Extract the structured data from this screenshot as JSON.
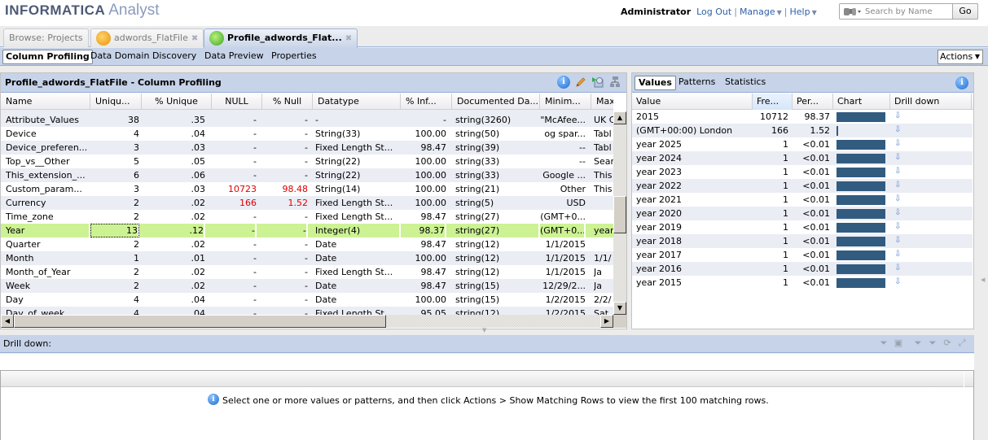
{
  "header": {
    "brand": "INFORMATICA",
    "product": "Analyst",
    "user": "Administrator",
    "logout": "Log Out",
    "manage": "Manage",
    "help": "Help",
    "search_placeholder": "Search by Name",
    "search_value": "",
    "go": "Go"
  },
  "tabs": [
    {
      "label": "Browse: Projects",
      "icon": "none",
      "closable": false,
      "active": false
    },
    {
      "label": "adwords_FlatFile",
      "icon": "flatfile-icon",
      "closable": true,
      "active": false
    },
    {
      "label": "Profile_adwords_Flat...",
      "icon": "profile-icon",
      "closable": true,
      "active": true
    }
  ],
  "subnav": {
    "items": [
      "Column Profiling",
      "Data Domain Discovery",
      "Data Preview",
      "Properties"
    ],
    "active": "Column Profiling",
    "actions": "Actions"
  },
  "profiling": {
    "title": "Profile_adwords_FlatFile - Column Profiling",
    "columns": [
      "Name",
      "Uniqu...",
      "% Unique",
      "NULL",
      "% Null",
      "Datatype",
      "% Inf...",
      "Documented Da...",
      "Minim...",
      "Max"
    ],
    "rows": [
      {
        "name": "Attribute_Values",
        "unique": "38",
        "pct_unique": ".35",
        "null": "-",
        "pct_null": "-",
        "datatype": "-",
        "pct_inf": "-",
        "documented": "string(3260)",
        "min": "\"McAfee...",
        "max": "UK C",
        "null_alert": false
      },
      {
        "name": "Device",
        "unique": "4",
        "pct_unique": ".04",
        "null": "-",
        "pct_null": "-",
        "datatype": "String(33)",
        "pct_inf": "100.00",
        "documented": "string(50)",
        "min": "og spar...",
        "max": "Tabl",
        "null_alert": false
      },
      {
        "name": "Device_preferen...",
        "unique": "3",
        "pct_unique": ".03",
        "null": "-",
        "pct_null": "-",
        "datatype": "Fixed Length St...",
        "pct_inf": "98.47",
        "documented": "string(39)",
        "min": "--",
        "max": "Tabl",
        "null_alert": false
      },
      {
        "name": "Top_vs__Other",
        "unique": "5",
        "pct_unique": ".05",
        "null": "-",
        "pct_null": "-",
        "datatype": "String(22)",
        "pct_inf": "100.00",
        "documented": "string(33)",
        "min": "--",
        "max": "Sear",
        "null_alert": false
      },
      {
        "name": "This_extension_...",
        "unique": "6",
        "pct_unique": ".06",
        "null": "-",
        "pct_null": "-",
        "datatype": "String(22)",
        "pct_inf": "100.00",
        "documented": "string(33)",
        "min": "Google ...",
        "max": "This",
        "null_alert": false
      },
      {
        "name": "Custom_param...",
        "unique": "3",
        "pct_unique": ".03",
        "null": "10723",
        "pct_null": "98.48",
        "datatype": "String(14)",
        "pct_inf": "100.00",
        "documented": "string(21)",
        "min": "Other",
        "max": "This",
        "null_alert": true
      },
      {
        "name": "Currency",
        "unique": "2",
        "pct_unique": ".02",
        "null": "166",
        "pct_null": "1.52",
        "datatype": "Fixed Length St...",
        "pct_inf": "100.00",
        "documented": "string(5)",
        "min": "USD",
        "max": "",
        "null_alert": true
      },
      {
        "name": "Time_zone",
        "unique": "2",
        "pct_unique": ".02",
        "null": "-",
        "pct_null": "-",
        "datatype": "Fixed Length St...",
        "pct_inf": "98.47",
        "documented": "string(27)",
        "min": "(GMT+0...",
        "max": "",
        "null_alert": false
      },
      {
        "name": "Year",
        "unique": "13",
        "pct_unique": ".12",
        "null": "-",
        "pct_null": "-",
        "datatype": "Integer(4)",
        "pct_inf": "98.37",
        "documented": "string(27)",
        "min": "(GMT+0...",
        "max": "year",
        "null_alert": false,
        "selected": true
      },
      {
        "name": "Quarter",
        "unique": "2",
        "pct_unique": ".02",
        "null": "-",
        "pct_null": "-",
        "datatype": "Date",
        "pct_inf": "98.47",
        "documented": "string(12)",
        "min": "1/1/2015",
        "max": "",
        "null_alert": false
      },
      {
        "name": "Month",
        "unique": "1",
        "pct_unique": ".01",
        "null": "-",
        "pct_null": "-",
        "datatype": "Date",
        "pct_inf": "100.00",
        "documented": "string(12)",
        "min": "1/1/2015",
        "max": "1/1/",
        "null_alert": false
      },
      {
        "name": "Month_of_Year",
        "unique": "2",
        "pct_unique": ".02",
        "null": "-",
        "pct_null": "-",
        "datatype": "Fixed Length St...",
        "pct_inf": "98.47",
        "documented": "string(12)",
        "min": "1/1/2015",
        "max": "Ja",
        "null_alert": false
      },
      {
        "name": "Week",
        "unique": "2",
        "pct_unique": ".02",
        "null": "-",
        "pct_null": "-",
        "datatype": "Date",
        "pct_inf": "98.47",
        "documented": "string(15)",
        "min": "12/29/2...",
        "max": "Ja",
        "null_alert": false
      },
      {
        "name": "Day",
        "unique": "4",
        "pct_unique": ".04",
        "null": "-",
        "pct_null": "-",
        "datatype": "Date",
        "pct_inf": "100.00",
        "documented": "string(15)",
        "min": "1/2/2015",
        "max": "2/2/",
        "null_alert": false
      },
      {
        "name": "Day_of_week",
        "unique": "4",
        "pct_unique": ".04",
        "null": "-",
        "pct_null": "-",
        "datatype": "Fixed Length St...",
        "pct_inf": "95.05",
        "documented": "string(12)",
        "min": "1/2/2015",
        "max": "Sat",
        "null_alert": false
      }
    ]
  },
  "values_panel": {
    "tabs": [
      "Values",
      "Patterns",
      "Statistics"
    ],
    "active_tab": "Values",
    "columns": [
      "Value",
      "Fre...",
      "Per...",
      "Chart",
      "Drill down"
    ],
    "rows": [
      {
        "value": "2015",
        "frequency": "10712",
        "percent": "98.37",
        "bar_fraction": 1.0
      },
      {
        "value": "(GMT+00:00) London",
        "frequency": "166",
        "percent": "1.52",
        "bar_fraction": 0.02
      },
      {
        "value": "year 2025",
        "frequency": "1",
        "percent": "<0.01",
        "bar_fraction": 1.0
      },
      {
        "value": "year 2024",
        "frequency": "1",
        "percent": "<0.01",
        "bar_fraction": 1.0
      },
      {
        "value": "year 2023",
        "frequency": "1",
        "percent": "<0.01",
        "bar_fraction": 1.0
      },
      {
        "value": "year 2022",
        "frequency": "1",
        "percent": "<0.01",
        "bar_fraction": 1.0
      },
      {
        "value": "year 2021",
        "frequency": "1",
        "percent": "<0.01",
        "bar_fraction": 1.0
      },
      {
        "value": "year 2020",
        "frequency": "1",
        "percent": "<0.01",
        "bar_fraction": 1.0
      },
      {
        "value": "year 2019",
        "frequency": "1",
        "percent": "<0.01",
        "bar_fraction": 1.0
      },
      {
        "value": "year 2018",
        "frequency": "1",
        "percent": "<0.01",
        "bar_fraction": 1.0
      },
      {
        "value": "year 2017",
        "frequency": "1",
        "percent": "<0.01",
        "bar_fraction": 1.0
      },
      {
        "value": "year 2016",
        "frequency": "1",
        "percent": "<0.01",
        "bar_fraction": 1.0
      },
      {
        "value": "year 2015",
        "frequency": "1",
        "percent": "<0.01",
        "bar_fraction": 1.0
      }
    ],
    "bar_color": "#325b80"
  },
  "drilldown": {
    "title": "Drill down:",
    "message": "Select one or more values or patterns, and then click Actions > Show Matching Rows to view the first 100 matching rows."
  },
  "colors": {
    "panel_header": "#c6d3e8",
    "selected_row": "#ccf293",
    "null_alert": "#e00000",
    "link": "#2e5fa8"
  }
}
